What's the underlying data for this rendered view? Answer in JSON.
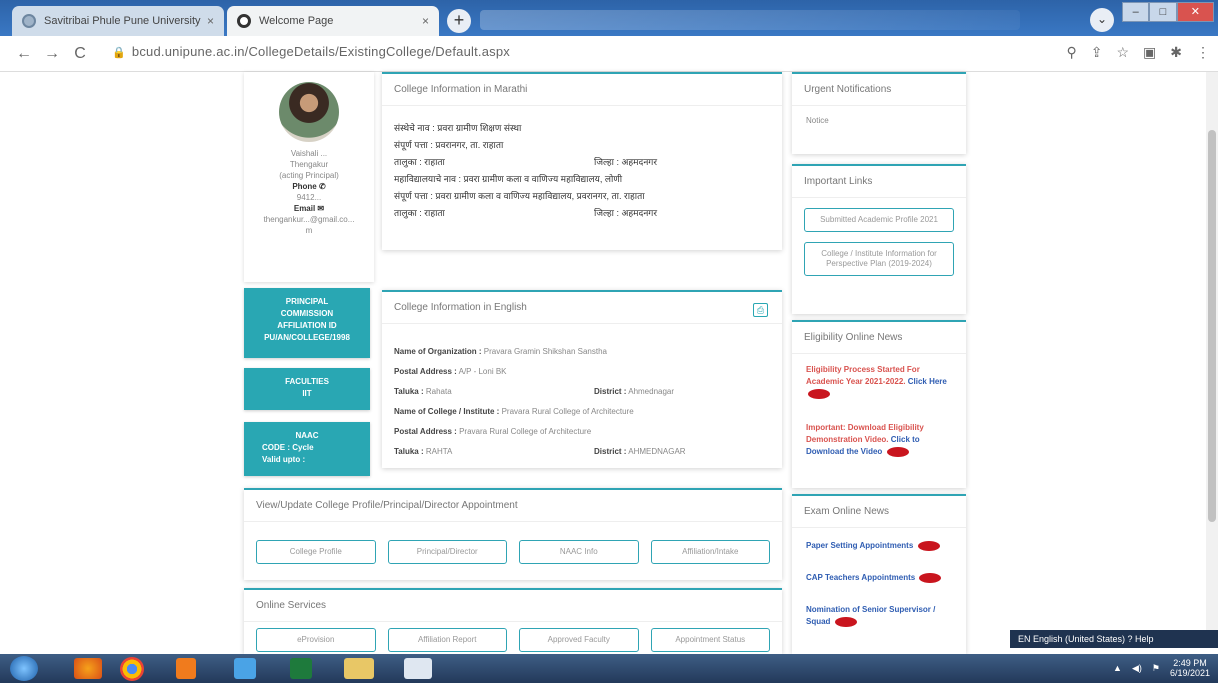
{
  "browser": {
    "tabs": [
      {
        "title": "Savitribai Phule Pune University",
        "close": "×"
      },
      {
        "title": "Welcome Page",
        "close": "×"
      }
    ],
    "new_tab": "+",
    "window_controls": [
      "–",
      "□",
      "✕"
    ],
    "url": "bcud.unipune.ac.in/CollegeDetails/ExistingCollege/Default.aspx",
    "nav": {
      "back": "←",
      "forward": "→",
      "reload": "C"
    },
    "toolbar_icons": [
      "⚲",
      "⇪",
      "☆",
      "▣",
      "✱",
      "⋮"
    ]
  },
  "profile": {
    "name": "Vaishali ...",
    "place": "Thengakur",
    "role": "(acting Principal)",
    "phone_label": "Phone ✆",
    "phone": "9412...",
    "email_label": "Email ✉",
    "email": "thengankur...@gmail.co...",
    "email_tail": "m"
  },
  "sidebar_boxes": {
    "principal": [
      "PRINCIPAL",
      "COMMISSION",
      "AFFILIATION ID",
      "PU/AN/COLLEGE/1998"
    ],
    "faculties": [
      "FACULTIES",
      "IIT"
    ],
    "naac": [
      "NAAC",
      "CODE : Cycle",
      "Valid upto :"
    ]
  },
  "marathi_card": {
    "title": "College Information in Marathi",
    "lines": [
      "संस्थेचे नाव : प्रवरा ग्रामीण शिक्षण संस्था",
      "संपूर्ण पत्ता : प्रवरानगर, ता. राहाता",
      {
        "left": "तालुका : राहाता",
        "right": "जिल्हा : अहमदनगर"
      },
      "महाविद्यालयाचे नाव : प्रवरा ग्रामीण कला व वाणिज्य महाविद्यालय, लोणी",
      "संपूर्ण पत्ता : प्रवरा ग्रामीण कला व वाणिज्य महाविद्यालय, प्रवरानगर, ता. राहाता",
      {
        "left": "तालुका : राहाता",
        "right": "जिल्हा : अहमदनगर"
      }
    ]
  },
  "english_card": {
    "title": "College Information in English",
    "print_icon": "⎙",
    "rows": [
      {
        "label": "Name of Organization :",
        "value": "Pravara Gramin Shikshan Sanstha"
      },
      {
        "label": "Postal Address :",
        "value": "A/P - Loni BK"
      },
      {
        "label": "Taluka :",
        "value": "Rahata",
        "label2": "District :",
        "value2": "Ahmednagar"
      },
      {
        "label": "Name of College / Institute :",
        "value": "Pravara Rural College of Architecture"
      },
      {
        "label": "Postal Address :",
        "value": "Pravara Rural College of Architecture"
      },
      {
        "label": "Taluka :",
        "value": "RAHTA",
        "label2": "District :",
        "value2": "AHMEDNAGAR"
      }
    ]
  },
  "view_update": {
    "title": "View/Update College Profile/Principal/Director Appointment",
    "buttons": [
      "College Profile",
      "Principal/Director",
      "NAAC Info",
      "Affiliation/Intake"
    ]
  },
  "online_services": {
    "title": "Online Services",
    "buttons": [
      "eProvision",
      "Affiliation Report",
      "Approved Faculty",
      "Appointment Status"
    ]
  },
  "urgent": {
    "title": "Urgent Notifications",
    "body": "Notice"
  },
  "important_links": {
    "title": "Important Links",
    "buttons": [
      "Submitted Academic Profile 2021",
      "College / Institute Information for Perspective Plan (2019-2024)"
    ]
  },
  "eligibility": {
    "title": "Eligibility Online News",
    "items": [
      {
        "text": "Eligibility Process Started For Academic Year 2021-2022. ",
        "link": "Click Here",
        "badge": "new"
      },
      {
        "text": "Important: Download Eligibility Demonstration Video. ",
        "link": "Click to Download the Video",
        "badge": "new"
      }
    ]
  },
  "exam": {
    "title": "Exam Online News",
    "items": [
      {
        "text": "Paper Setting Appointments",
        "badge": "new"
      },
      {
        "text": "CAP Teachers Appointments",
        "badge": "new"
      },
      {
        "text": "Nomination of Senior Supervisor / Squad",
        "badge": "new"
      }
    ]
  },
  "language_bar": "EN English (United States)   ? Help",
  "taskbar": {
    "time": "2:49 PM",
    "date": "6/19/2021"
  },
  "colors": {
    "teal": "#29a7b3",
    "red_news": "#d9534f",
    "link_blue": "#2f5db2"
  }
}
